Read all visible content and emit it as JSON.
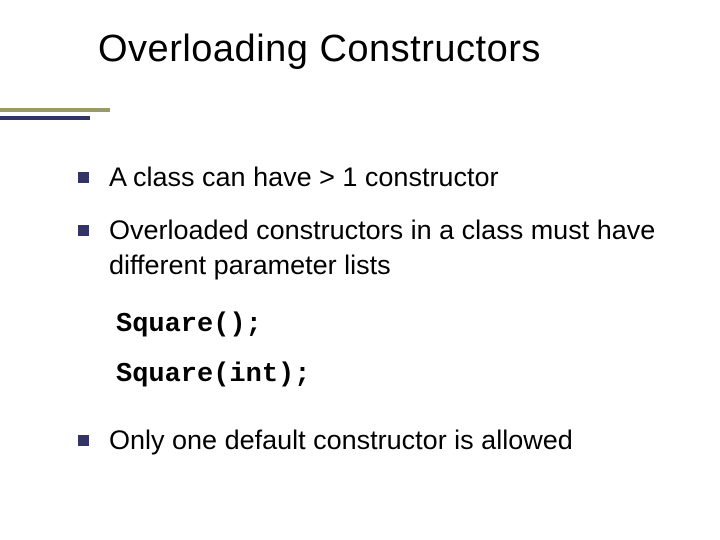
{
  "title": "Overloading Constructors",
  "bullets": {
    "b1": "A class can have > 1 constructor",
    "b2": "Overloaded constructors in a class must have different parameter lists",
    "b3": "Only one default constructor is allowed"
  },
  "code": {
    "line1": "Square();",
    "line2": "Square(int);"
  }
}
